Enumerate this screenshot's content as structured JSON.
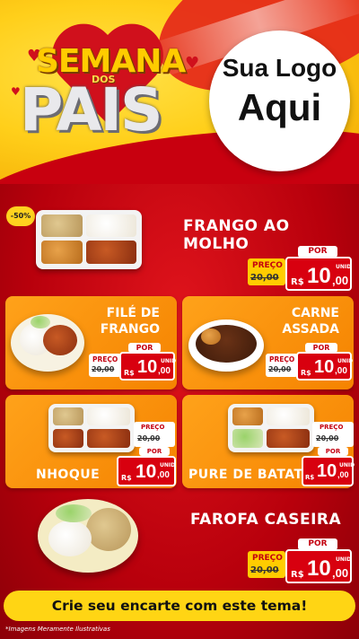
{
  "header": {
    "campaign_title_top": "SEMANA",
    "campaign_title_mid": "DOS",
    "campaign_title_bottom": "PAIS",
    "logo_placeholder_line1": "Sua Logo",
    "logo_placeholder_line2": "Aqui"
  },
  "labels": {
    "preco": "PREÇO",
    "por": "POR",
    "currency": "R$",
    "unit": "UNID"
  },
  "discount_badge": "-50%",
  "products": [
    {
      "name": "FRANGO AO MOLHO",
      "old_price": "20,00",
      "price_int": "10",
      "price_dec": ",00"
    },
    {
      "name_line1": "FILÉ DE",
      "name_line2": "FRANGO",
      "old_price": "20,00",
      "price_int": "10",
      "price_dec": ",00"
    },
    {
      "name_line1": "CARNE",
      "name_line2": "ASSADA",
      "old_price": "20,00",
      "price_int": "10",
      "price_dec": ",00"
    },
    {
      "name": "NHOQUE",
      "old_price": "20,00",
      "price_int": "10",
      "price_dec": ",00"
    },
    {
      "name": "PURE DE BATATA",
      "old_price": "20,00",
      "price_int": "10",
      "price_dec": ",00"
    },
    {
      "name": "FAROFA CASEIRA",
      "old_price": "20,00",
      "price_int": "10",
      "price_dec": ",00"
    }
  ],
  "cta": "Crie seu encarte com este tema!",
  "disclaimer": "*Imagens Meramente Ilustrativas",
  "colors": {
    "brand_red": "#c40010",
    "brand_yellow": "#ffd514",
    "card_orange": "#f58300"
  }
}
